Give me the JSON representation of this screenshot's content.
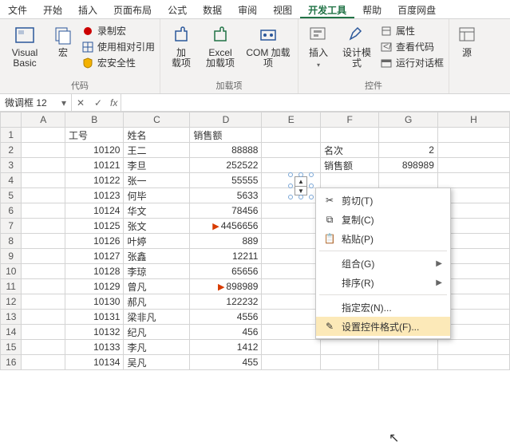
{
  "tabs": [
    "文件",
    "开始",
    "插入",
    "页面布局",
    "公式",
    "数据",
    "审阅",
    "视图",
    "开发工具",
    "帮助",
    "百度网盘"
  ],
  "active_tab": "开发工具",
  "ribbon": {
    "g1": {
      "label": "代码",
      "vb": "Visual Basic",
      "macro": "宏",
      "rec": "录制宏",
      "rel": "使用相对引用",
      "sec": "宏安全性"
    },
    "g2": {
      "label": "加载项",
      "addin": "加\n载项",
      "excel": "Excel\n加载项",
      "com": "COM 加载项"
    },
    "g3": {
      "label": "控件",
      "insert": "插入",
      "design": "设计模式",
      "prop": "属性",
      "view": "查看代码",
      "dlg": "运行对话框"
    },
    "g4": {
      "src": "源"
    }
  },
  "namebox": "微调框 12",
  "fx": "fx",
  "cols": [
    "",
    "A",
    "B",
    "C",
    "D",
    "E",
    "F",
    "G",
    "H"
  ],
  "rows": [
    {
      "n": 1,
      "A": "",
      "B": "工号",
      "C": "姓名",
      "D": "销售额",
      "E": "",
      "F": "",
      "G": "",
      "H": ""
    },
    {
      "n": 2,
      "A": "",
      "B": "10120",
      "C": "王二",
      "D": "88888",
      "E": "",
      "F": "名次",
      "G": "2",
      "H": ""
    },
    {
      "n": 3,
      "A": "",
      "B": "10121",
      "C": "李旦",
      "D": "252522",
      "E": "",
      "F": "销售额",
      "G": "898989",
      "H": ""
    },
    {
      "n": 4,
      "A": "",
      "B": "10122",
      "C": "张一",
      "D": "55555",
      "E": "",
      "F": "",
      "G": "",
      "H": ""
    },
    {
      "n": 5,
      "A": "",
      "B": "10123",
      "C": "何毕",
      "D": "5633",
      "E": "",
      "F": "",
      "G": "",
      "H": ""
    },
    {
      "n": 6,
      "A": "",
      "B": "10124",
      "C": "华文",
      "D": "78456",
      "E": "",
      "F": "",
      "G": "",
      "H": ""
    },
    {
      "n": 7,
      "A": "",
      "B": "10125",
      "C": "张文",
      "D": "4456656",
      "Dflag": true,
      "E": "",
      "F": "",
      "G": "",
      "H": ""
    },
    {
      "n": 8,
      "A": "",
      "B": "10126",
      "C": "叶婷",
      "D": "889",
      "E": "",
      "F": "",
      "G": "",
      "H": ""
    },
    {
      "n": 9,
      "A": "",
      "B": "10127",
      "C": "张鑫",
      "D": "12211",
      "E": "",
      "F": "",
      "G": "",
      "H": ""
    },
    {
      "n": 10,
      "A": "",
      "B": "10128",
      "C": "李琼",
      "D": "65656",
      "E": "",
      "F": "",
      "G": "",
      "H": ""
    },
    {
      "n": 11,
      "A": "",
      "B": "10129",
      "C": "曾凡",
      "D": "898989",
      "Dflag": true,
      "E": "",
      "F": "",
      "G": "",
      "H": ""
    },
    {
      "n": 12,
      "A": "",
      "B": "10130",
      "C": "郝凡",
      "D": "122232",
      "E": "",
      "F": "",
      "G": "",
      "H": ""
    },
    {
      "n": 13,
      "A": "",
      "B": "10131",
      "C": "梁非凡",
      "D": "4556",
      "E": "",
      "F": "",
      "G": "",
      "H": ""
    },
    {
      "n": 14,
      "A": "",
      "B": "10132",
      "C": "纪凡",
      "D": "456",
      "E": "",
      "F": "",
      "G": "",
      "H": ""
    },
    {
      "n": 15,
      "A": "",
      "B": "10133",
      "C": "李凡",
      "D": "1412",
      "E": "",
      "F": "",
      "G": "",
      "H": ""
    },
    {
      "n": 16,
      "A": "",
      "B": "10134",
      "C": "吴凡",
      "D": "455",
      "E": "",
      "F": "",
      "G": "",
      "H": ""
    }
  ],
  "ctx": {
    "cut": "剪切(T)",
    "copy": "复制(C)",
    "paste": "粘贴(P)",
    "group": "组合(G)",
    "order": "排序(R)",
    "assign": "指定宏(N)...",
    "format": "设置控件格式(F)..."
  }
}
